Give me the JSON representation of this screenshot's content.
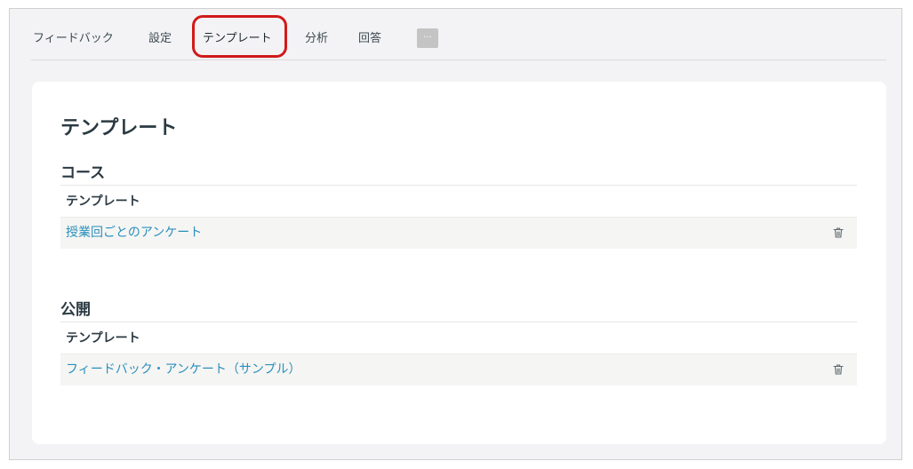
{
  "tabs": [
    {
      "label": "フィードバック"
    },
    {
      "label": "設定"
    },
    {
      "label": "テンプレート",
      "active": true
    },
    {
      "label": "分析"
    },
    {
      "label": "回答"
    }
  ],
  "more_label": "···",
  "page_title": "テンプレート",
  "sections": [
    {
      "title": "コース",
      "column_header": "テンプレート",
      "rows": [
        {
          "name": "授業回ごとのアンケート",
          "action_icon": "trash-icon"
        }
      ]
    },
    {
      "title": "公開",
      "column_header": "テンプレート",
      "rows": [
        {
          "name": "フィードバック・アンケート（サンプル）",
          "action_icon": "trash-icon"
        }
      ]
    }
  ],
  "colors": {
    "highlight": "#d11a1a",
    "link": "#2a8fbd",
    "background": "#f3f3f5"
  }
}
